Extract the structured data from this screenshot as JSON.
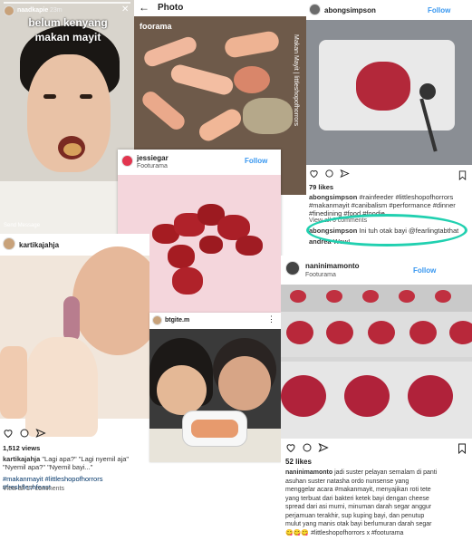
{
  "story": {
    "username": "naadkapie",
    "time": "23m",
    "text_line1": "belum kenyang",
    "text_line2": "makan mayit",
    "send_message": "Send Message"
  },
  "photo_header": {
    "title": "Photo",
    "username": "foorama",
    "side_text": "Makan Mayit | littleshopofhorrors"
  },
  "abong": {
    "username": "abongsimpson",
    "follow": "Follow",
    "likes": "79 likes",
    "caption_user": "abongsimpson",
    "caption_text": "#rainfeeder #littleshopofhorrors #makanmayit #canibalism #performance #dinner #finedining #food #foodie",
    "view_comments": "View all 6 comments",
    "comment1_user": "abongsimpson",
    "comment1_text": "Ini tuh otak bayi @fearlingtabthat",
    "comment2_user": "andrea",
    "comment2_text": "Wow!"
  },
  "jessi": {
    "username": "jessiegar",
    "subtitle": "Footurama",
    "follow": "Follow"
  },
  "kartika": {
    "username": "kartikajahja",
    "views": "1,512 views",
    "caption_user": "kartikajahja",
    "caption_text": "\"Lagi apa?\" \"Lagi nyemil aja\" \"Nyemil apa?\" \"Nyemil bayi...\"",
    "hashtags": "#makanmayit #littleshopofhorrors #freshfleshfeast",
    "view_comments": "View all 17 comments"
  },
  "btg": {
    "username": "btgite.m"
  },
  "nanin": {
    "username": "naninimamonto",
    "subtitle": "Footurama",
    "follow": "Follow",
    "likes": "52 likes",
    "caption_user": "naninimamonto",
    "caption_lines": [
      "jadi suster pelayan semalam di panti",
      "asuhan suster natasha ordo nunsense yang",
      "menggelar acara #makanmayit, menyajikan roti tete",
      "yang terbuat dari bakteri ketek bayi dengan cheese",
      "spread dari asi murni, minuman darah segar anggur",
      "perjamuan terakhir, sup kuping bayi, dan penutup",
      "mulut yang manis otak bayi berlumuran darah segar",
      "😋😋😋 #littleshopofhorrors x #footurama"
    ]
  },
  "colors": {
    "link_blue": "#3897f0",
    "highlight_teal": "#21d0b0",
    "meat_red": "#a51c22",
    "pink_bg": "#f4d6dc"
  }
}
